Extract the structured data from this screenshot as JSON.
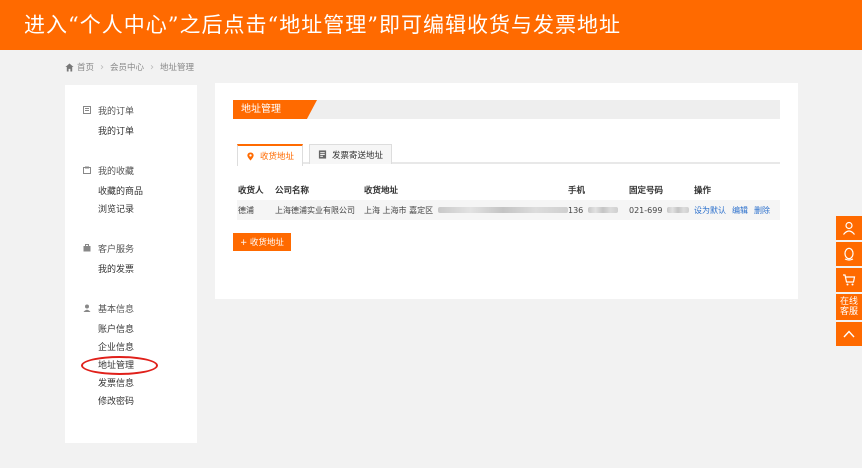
{
  "banner": {
    "text": "进入“个人中心”之后点击“地址管理”即可编辑收货与发票地址"
  },
  "breadcrumb": {
    "home": "首页",
    "level1": "会员中心",
    "level2": "地址管理"
  },
  "sidebar": {
    "groups": [
      {
        "title": "我的订单",
        "items": [
          "我的订单"
        ]
      },
      {
        "title": "我的收藏",
        "items": [
          "收藏的商品",
          "浏览记录"
        ]
      },
      {
        "title": "客户服务",
        "items": [
          "我的发票"
        ]
      },
      {
        "title": "基本信息",
        "items": [
          "账户信息",
          "企业信息",
          "地址管理",
          "发票信息",
          "修改密码"
        ]
      }
    ]
  },
  "main": {
    "section_title": "地址管理",
    "tabs": [
      "收货地址",
      "发票寄送地址"
    ],
    "table": {
      "headers": [
        "收货人",
        "公司名称",
        "收货地址",
        "手机",
        "固定号码",
        "操作"
      ],
      "rows": [
        {
          "name": "德浦",
          "company": "上海德浦实业有限公司",
          "address": "上海 上海市 嘉定区",
          "mobile": "136",
          "phone": "021-699",
          "actions": [
            "设为默认",
            "编辑",
            "删除"
          ]
        }
      ]
    },
    "add_button": "+ 收货地址"
  },
  "float_bar": {
    "service": "在线客服"
  },
  "colors": {
    "accent": "#ff6a00",
    "link": "#2a6fcc",
    "highlight_circle": "#e0201a"
  }
}
